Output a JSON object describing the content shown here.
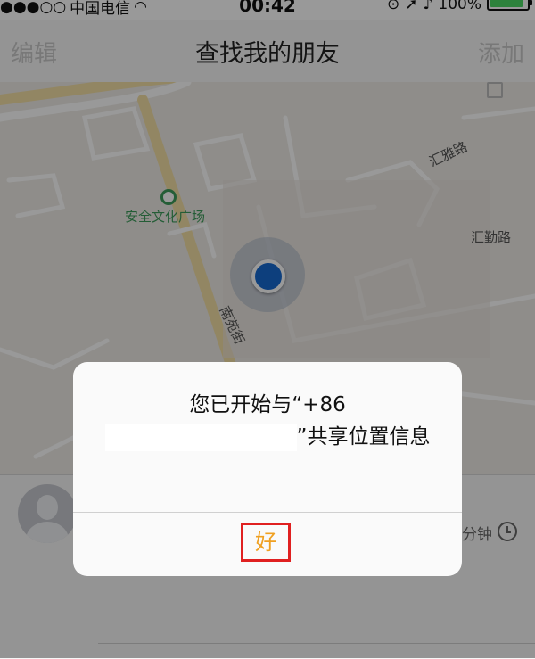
{
  "status_bar": {
    "carrier": "中国电信",
    "time": "00:42",
    "battery": "100%"
  },
  "nav": {
    "edit": "编辑",
    "title": "查找我的朋友",
    "add": "添加"
  },
  "map": {
    "poi": "安全文化广场",
    "road_1": "汇雅路",
    "road_2": "汇勤路",
    "road_3": "南苑街"
  },
  "friend": {
    "time_ago": "分钟"
  },
  "alert": {
    "message_part1": "您已开始与“+86",
    "message_part2": "”共享位置信息",
    "ok_button": "好"
  },
  "colors": {
    "accent_orange": "#f0a020",
    "highlight_red": "#e02020",
    "location_blue": "#1769d1",
    "battery_green": "#4cd964"
  }
}
